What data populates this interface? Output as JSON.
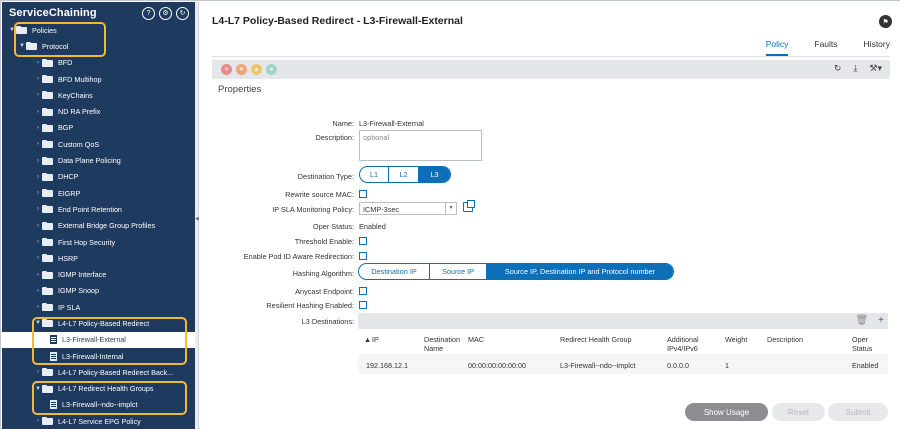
{
  "sidebar": {
    "title": "ServiceChaining",
    "header_icons": [
      "help-circle-icon",
      "settings-circle-icon",
      "refresh-circle-icon"
    ],
    "tree": [
      {
        "label": "Policies",
        "level": 0,
        "expanded": true,
        "type": "folder"
      },
      {
        "label": "Protocol",
        "level": 1,
        "expanded": true,
        "type": "folder"
      },
      {
        "label": "BFD",
        "level": 2,
        "type": "folder"
      },
      {
        "label": "BFD Multihop",
        "level": 2,
        "type": "folder"
      },
      {
        "label": "KeyChains",
        "level": 2,
        "type": "folder"
      },
      {
        "label": "ND RA Prefix",
        "level": 2,
        "type": "folder"
      },
      {
        "label": "BGP",
        "level": 2,
        "type": "folder"
      },
      {
        "label": "Custom QoS",
        "level": 2,
        "type": "folder"
      },
      {
        "label": "Data Plane Policing",
        "level": 2,
        "type": "folder"
      },
      {
        "label": "DHCP",
        "level": 2,
        "type": "folder"
      },
      {
        "label": "EIGRP",
        "level": 2,
        "type": "folder"
      },
      {
        "label": "End Point Retention",
        "level": 2,
        "type": "folder"
      },
      {
        "label": "External Bridge Group Profiles",
        "level": 2,
        "type": "folder"
      },
      {
        "label": "First Hop Security",
        "level": 2,
        "type": "folder"
      },
      {
        "label": "HSRP",
        "level": 2,
        "type": "folder"
      },
      {
        "label": "IGMP Interface",
        "level": 2,
        "type": "folder"
      },
      {
        "label": "IGMP Snoop",
        "level": 2,
        "type": "folder"
      },
      {
        "label": "IP SLA",
        "level": 2,
        "type": "folder"
      },
      {
        "label": "L4-L7 Policy-Based Redirect",
        "level": 2,
        "expanded": true,
        "type": "folder"
      },
      {
        "label": "L3-Firewall-External",
        "level": 3,
        "type": "doc",
        "selected": true
      },
      {
        "label": "L3-Firewall-Internal",
        "level": 3,
        "type": "doc"
      },
      {
        "label": "L4-L7 Policy-Based Redirect Back...",
        "level": 2,
        "type": "folder"
      },
      {
        "label": "L4-L7 Redirect Health Groups",
        "level": 2,
        "expanded": true,
        "type": "folder"
      },
      {
        "label": "L3-Firewall--ndo--implct",
        "level": 3,
        "type": "doc"
      },
      {
        "label": "L4-L7 Service EPG Policy",
        "level": 2,
        "type": "folder"
      }
    ]
  },
  "main": {
    "title": "L4-L7 Policy-Based Redirect - L3-Firewall-External",
    "tabs": [
      {
        "label": "Policy",
        "active": true
      },
      {
        "label": "Faults",
        "active": false
      },
      {
        "label": "History",
        "active": false
      }
    ],
    "section_title": "Properties",
    "fields": {
      "name_label": "Name:",
      "name_value": "L3-Firewall-External",
      "description_label": "Description:",
      "description_placeholder": "optional",
      "destination_type_label": "Destination Type:",
      "destination_type_options": [
        "L1",
        "L2",
        "L3"
      ],
      "destination_type_selected": "L3",
      "rewrite_mac_label": "Rewrite source MAC:",
      "ip_sla_label": "IP SLA Monitoring Policy:",
      "ip_sla_value": "ICMP-3sec",
      "oper_status_label": "Oper Status:",
      "oper_status_value": "Enabled",
      "threshold_label": "Threshold Enable:",
      "pod_id_label": "Enable Pod ID Aware Redirection:",
      "hashing_label": "Hashing Algorithm:",
      "hashing_options": [
        "Destination IP",
        "Source IP",
        "Source IP, Destination IP and Protocol number"
      ],
      "hashing_selected": "Source IP, Destination IP and Protocol number",
      "anycast_label": "Anycast Endpoint:",
      "resilient_label": "Resilient Hashing Enabled:",
      "l3_destinations_label": "L3 Destinations:"
    },
    "table": {
      "columns": [
        "IP",
        "Destination Name",
        "MAC",
        "Redirect Health Group",
        "Additional IPv4/IPv6",
        "Weight",
        "Description",
        "Oper Status"
      ],
      "rows": [
        {
          "ip": "192.168.12.1",
          "dest_name": "",
          "mac": "00:00:00:00:00:00",
          "health_group": "L3-Firewall--ndo--implct",
          "additional": "0.0.0.0",
          "weight": "1",
          "description": "",
          "status": "Enabled"
        }
      ]
    },
    "buttons": {
      "show_usage": "Show Usage",
      "reset": "Reset",
      "submit": "Submit"
    }
  },
  "colors": {
    "sidebar_bg": "#1f3a5f",
    "accent": "#0d6fb8",
    "highlight": "#f2b933"
  }
}
